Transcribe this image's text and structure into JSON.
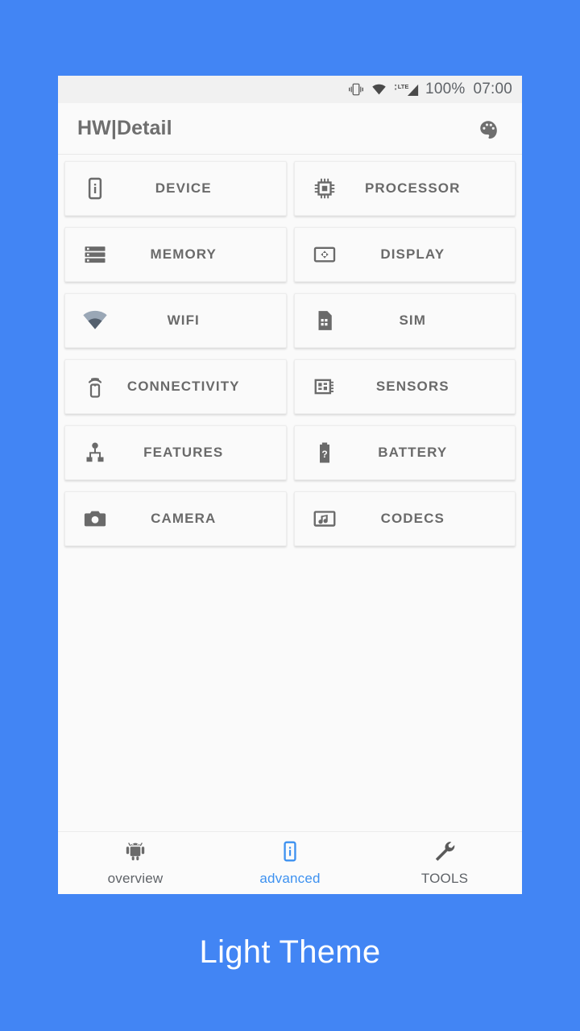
{
  "theme": {
    "background": "#4285f4",
    "accent": "#3d91f0",
    "card_bg": "#fafafa",
    "icon_color": "#6a6a6a",
    "text_color": "#6a6a6a"
  },
  "statusbar": {
    "vibrate_icon": "vibrate-icon",
    "wifi_icon": "wifi-icon",
    "signal_icon": "lte-signal-icon",
    "lte_label": "LTE",
    "battery_percent": "100%",
    "time": "07:00"
  },
  "toolbar": {
    "title": "HW|Detail",
    "palette_icon": "palette-icon"
  },
  "grid": {
    "items": [
      {
        "label": "DEVICE",
        "icon": "device-info-icon"
      },
      {
        "label": "PROCESSOR",
        "icon": "cpu-chip-icon"
      },
      {
        "label": "MEMORY",
        "icon": "memory-modules-icon"
      },
      {
        "label": "DISPLAY",
        "icon": "display-icon"
      },
      {
        "label": "WIFI",
        "icon": "wifi-icon"
      },
      {
        "label": "SIM",
        "icon": "sim-card-icon"
      },
      {
        "label": "CONNECTIVITY",
        "icon": "connectivity-icon"
      },
      {
        "label": "SENSORS",
        "icon": "sensors-chip-icon"
      },
      {
        "label": "FEATURES",
        "icon": "features-tree-icon"
      },
      {
        "label": "BATTERY",
        "icon": "battery-unknown-icon"
      },
      {
        "label": "CAMERA",
        "icon": "camera-icon"
      },
      {
        "label": "CODECS",
        "icon": "codecs-music-icon"
      }
    ]
  },
  "bottomnav": {
    "items": [
      {
        "label": "overview",
        "icon": "android-robot-icon",
        "active": false
      },
      {
        "label": "advanced",
        "icon": "device-info-icon",
        "active": true
      },
      {
        "label": "TOOLS",
        "icon": "wrench-icon",
        "active": false
      }
    ]
  },
  "caption": {
    "text": "Light Theme"
  }
}
